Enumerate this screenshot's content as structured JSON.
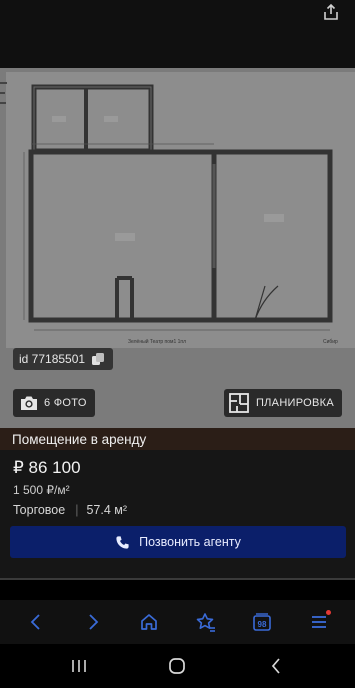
{
  "listing": {
    "id_label": "id 77185501",
    "photos_label": "6 ФОТО",
    "floorplan_label": "ПЛАНИРОВКА",
    "title": "Помещение в аренду",
    "price": "₽ 86 100",
    "price_per_sqm": "1 500 ₽/м²",
    "property_type": "Торговое",
    "area": "57.4 м²",
    "call_button": "Позвонить агенту"
  },
  "plan_caption_left": "Зелёный Театр пом1 1пл",
  "plan_caption_right": "Сибир",
  "icons": {
    "share": "share-icon",
    "copy": "copy-icon",
    "camera": "camera-icon",
    "floorplan": "floorplan-icon",
    "phone": "phone-icon",
    "back": "back-icon",
    "forward": "forward-icon",
    "home": "home-icon",
    "bookmark": "bookmark-star-icon",
    "tabs": "tabs-icon",
    "menu": "menu-icon"
  },
  "browser": {
    "tab_count": "98"
  },
  "colors": {
    "title_bar": "#2b1e17",
    "call_button": "#0b1f6a",
    "accent_icon": "#3a6bd8",
    "notification_dot": "#e53935"
  }
}
